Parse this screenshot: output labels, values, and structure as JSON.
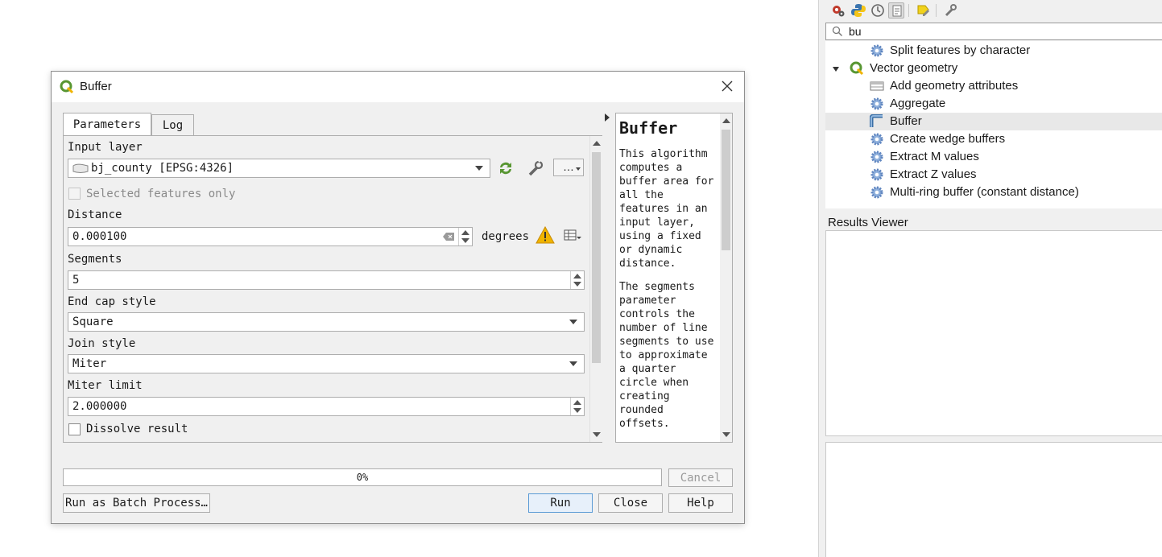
{
  "processing": {
    "search": {
      "value": "bu"
    },
    "tree": [
      {
        "label": "Split features by character",
        "icon": "gear-icon",
        "kind": "algorithm"
      },
      {
        "label": "Vector geometry",
        "icon": "qgis-logo-icon",
        "kind": "group",
        "expanded": true
      },
      {
        "label": "Add geometry attributes",
        "icon": "table-icon",
        "kind": "algorithm"
      },
      {
        "label": "Aggregate",
        "icon": "gear-icon",
        "kind": "algorithm"
      },
      {
        "label": "Buffer",
        "icon": "buffer-icon",
        "kind": "algorithm",
        "selected": true
      },
      {
        "label": "Create wedge buffers",
        "icon": "gear-icon",
        "kind": "algorithm"
      },
      {
        "label": "Extract M values",
        "icon": "gear-icon",
        "kind": "algorithm"
      },
      {
        "label": "Extract Z values",
        "icon": "gear-icon",
        "kind": "algorithm"
      },
      {
        "label": "Multi-ring buffer (constant distance)",
        "icon": "gear-icon",
        "kind": "algorithm"
      }
    ],
    "results_title": "Results Viewer"
  },
  "dialog": {
    "title": "Buffer",
    "tabs": {
      "parameters": "Parameters",
      "log": "Log"
    },
    "fields": {
      "input_layer_label": "Input layer",
      "input_layer_value": "bj_county [EPSG:4326]",
      "input_layer_more": "…",
      "selected_only_label": "Selected features only",
      "distance_label": "Distance",
      "distance_value": "0.000100",
      "distance_unit": "degrees",
      "segments_label": "Segments",
      "segments_value": "5",
      "end_cap_label": "End cap style",
      "end_cap_value": "Square",
      "join_label": "Join style",
      "join_value": "Miter",
      "miter_label": "Miter limit",
      "miter_value": "2.000000",
      "dissolve_label": "Dissolve result"
    },
    "help": {
      "title": "Buffer",
      "p1": "This algorithm computes a buffer area for all the features in an input layer, using a fixed or dynamic distance.",
      "p2": "The segments parameter controls the number of line segments to use to approximate a quarter circle when creating rounded offsets."
    },
    "progress": {
      "value": 0,
      "text": "0%"
    },
    "buttons": {
      "cancel": "Cancel",
      "batch": "Run as Batch Process…",
      "run": "Run",
      "close": "Close",
      "help": "Help"
    }
  },
  "colors": {
    "accent": "#5b9bd5",
    "qgis_green": "#589632",
    "warning": "#f0b400",
    "gear_blue": "#6a8fc7"
  }
}
